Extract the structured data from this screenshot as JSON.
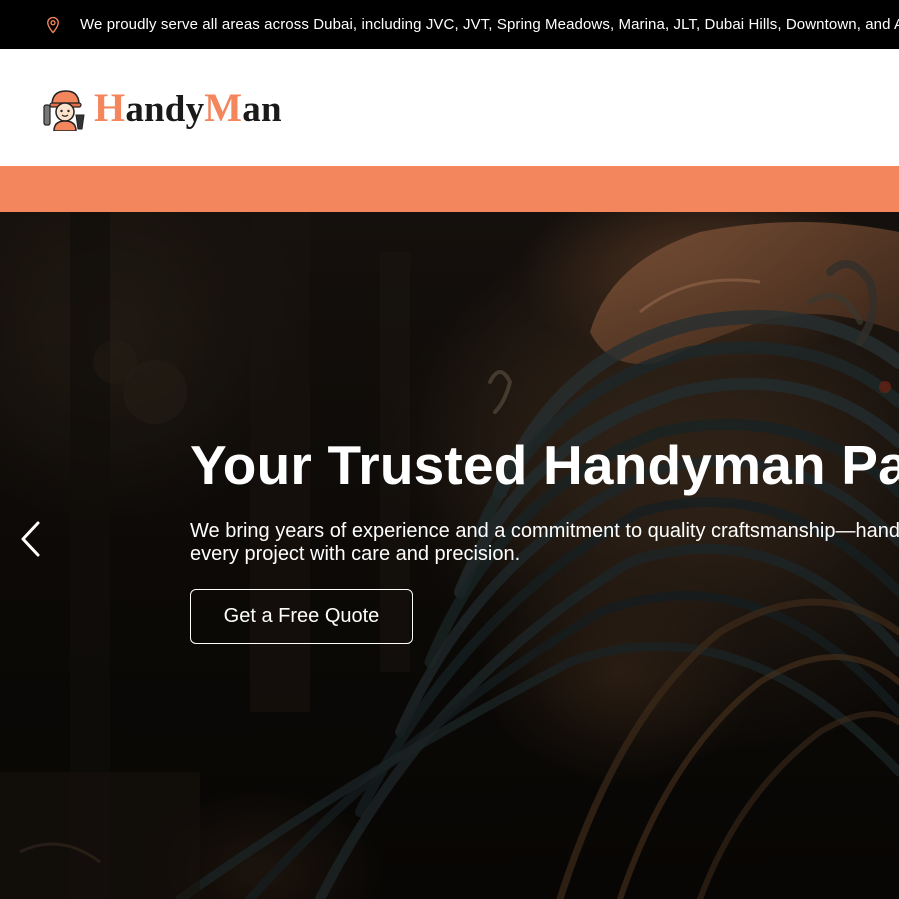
{
  "topbar": {
    "icon": "location-pin-icon",
    "message": "We proudly serve all areas across Dubai, including JVC, JVT, Spring Meadows, Marina, JLT, Dubai Hills, Downtown, and Arabian Ranches"
  },
  "header": {
    "logo": {
      "mascot_icon": "handyman-mascot-icon",
      "part1_initial": "H",
      "part1_rest": "andy",
      "part2_initial": "M",
      "part2_rest": "an"
    }
  },
  "hero": {
    "title": "Your Trusted Handyman Partner",
    "subtitle_line1": "We bring years of experience and a commitment to quality craftsmanship—handling",
    "subtitle_line2": "every project with care and precision.",
    "cta_label": "Get a Free Quote",
    "prev_icon": "chevron-left-icon"
  },
  "colors": {
    "accent": "#f4865d",
    "topbar_bg": "#000000",
    "header_bg": "#ffffff"
  }
}
